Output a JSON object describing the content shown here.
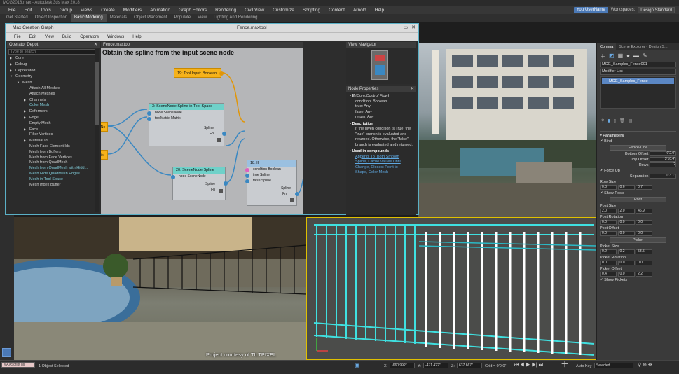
{
  "window": {
    "title": "MCG2018.max - Autodesk 3ds Max 2018"
  },
  "menubar": {
    "items": [
      "File",
      "Edit",
      "Tools",
      "Group",
      "Views",
      "Create",
      "Modifiers",
      "Animation",
      "Graph Editors",
      "Rendering",
      "Civil View",
      "Customize",
      "Scripting",
      "Content",
      "Arnold",
      "Help"
    ]
  },
  "user": {
    "name": "YourUserName",
    "workspaces_label": "Workspaces:",
    "workspace": "Design Standard"
  },
  "ribbon": {
    "tabs": [
      "Get Started",
      "Object Inspection",
      "Basic Modeling",
      "Materials",
      "Object Placement",
      "Populate",
      "View",
      "Lighting And Rendering"
    ],
    "active": 2
  },
  "mcg": {
    "title": "Max Creation Graph",
    "path": "Fence.maxtool",
    "menu": [
      "File",
      "Edit",
      "View",
      "Build",
      "Operators",
      "Windows",
      "Help"
    ],
    "operator_depot": {
      "title": "Operator Depot",
      "search_placeholder": "Type to search",
      "items": [
        {
          "label": "Core",
          "indent": 0,
          "arrow": "▶"
        },
        {
          "label": "Debug",
          "indent": 0,
          "arrow": "▶"
        },
        {
          "label": "Deprecated",
          "indent": 0,
          "arrow": "▶"
        },
        {
          "label": "Geometry",
          "indent": 0,
          "arrow": "▼"
        },
        {
          "label": "Mesh",
          "indent": 1,
          "arrow": "▼"
        },
        {
          "label": "Attach All Meshes",
          "indent": 2,
          "arrow": ""
        },
        {
          "label": "Attach Meshes",
          "indent": 2,
          "arrow": ""
        },
        {
          "label": "Channels",
          "indent": 2,
          "arrow": "▶"
        },
        {
          "label": "Color Mesh",
          "indent": 2,
          "arrow": "",
          "hl": true
        },
        {
          "label": "Deformers",
          "indent": 2,
          "arrow": "▶"
        },
        {
          "label": "Edge",
          "indent": 2,
          "arrow": "▶"
        },
        {
          "label": "Empty Mesh",
          "indent": 2,
          "arrow": ""
        },
        {
          "label": "Face",
          "indent": 2,
          "arrow": "▶"
        },
        {
          "label": "Filter Vertices",
          "indent": 2,
          "arrow": ""
        },
        {
          "label": "Material Id",
          "indent": 2,
          "arrow": "▶"
        },
        {
          "label": "Mesh Face Element Ids",
          "indent": 2,
          "arrow": ""
        },
        {
          "label": "Mesh from Buffers",
          "indent": 2,
          "arrow": ""
        },
        {
          "label": "Mesh from Face Vertices",
          "indent": 2,
          "arrow": ""
        },
        {
          "label": "Mesh from QuadMesh",
          "indent": 2,
          "arrow": ""
        },
        {
          "label": "Mesh from QuadMesh with Hidd...",
          "indent": 2,
          "arrow": "",
          "hl": true
        },
        {
          "label": "Mesh Hide QuadMesh Edges",
          "indent": 2,
          "arrow": "",
          "hl": true
        },
        {
          "label": "Mesh in Tool Space",
          "indent": 2,
          "arrow": "",
          "hl": true
        },
        {
          "label": "Mesh Index Buffer",
          "indent": 2,
          "arrow": ""
        }
      ]
    },
    "graph": {
      "tab": "Fence.maxtool",
      "title": "Obtain the spline from the input scene node",
      "nodes": {
        "n1": {
          "title": "19: Tool Input: Boolean"
        },
        "n2": {
          "title": "3: SceneNode Spline in Tool Space",
          "rows": [
            "node SceneNode",
            "toolMatrix Matrix"
          ],
          "outs": [
            "Spline",
            "Fn"
          ]
        },
        "n3": {
          "title": "20: SceneNode Spline",
          "rows": [
            "node SceneNode"
          ],
          "outs": [
            "Spline",
            "Fn"
          ]
        },
        "n4": {
          "title": "18: If",
          "rows": [
            "condition Boolean",
            "true Spline",
            "false Spline"
          ],
          "outs": [
            "Spline",
            "Fn"
          ]
        },
        "stub1": "eNo",
        "stub2": "trix"
      }
    },
    "navigator": {
      "title": "View Navigator"
    },
    "node_properties": {
      "title": "Node Properties",
      "heading": "If",
      "heading_type": "(Core.Control Flow)",
      "params": [
        "condition: Boolean",
        "true: Any",
        "false: Any",
        "return: Any"
      ],
      "desc_title": "Description",
      "description": "If the given condition is True, the \"true\" branch is evaluated and returned. Otherwise, the \"false\" branch is evaluated and returned.",
      "used_title": "Used in compounds",
      "links": [
        "Append_To_Both Smooth",
        "Spline, Cache Values Until",
        "Change, Closest Point to",
        "Shape, Color Mesh"
      ]
    }
  },
  "viewport_br": {
    "credit": "Project courtesy of TILTPIXEL"
  },
  "right_panel": {
    "tabs": [
      "Comma",
      "Scene Explorer - Design S..."
    ],
    "object_name": "MCG_Samples_Fence001",
    "modifier_list": "Modifier List",
    "stack_item": "MCG_Samples_Fence",
    "params_title": "Parameters",
    "bind": "Bind",
    "fence_line_btn": "Fence-Line",
    "bottom_offset_label": "Bottom Offset",
    "bottom_offset": "0'2.0\"",
    "top_offset_label": "Top Offset",
    "top_offset": "3'10.4\"",
    "rows_label": "Rows",
    "rows": "2",
    "force_up": "Force Up",
    "separation_label": "Separation",
    "separation": "0'3.1\"",
    "row_size": "Row Size",
    "row_size_vals": [
      "0.3",
      "0.6",
      "0.7"
    ],
    "show_posts": "Show Posts",
    "post_btn": "Post",
    "post_size": "Post Size",
    "post_size_vals": [
      "2.0",
      "2.0",
      "46.9"
    ],
    "post_rotation": "Post Rotation",
    "post_rotation_vals": [
      "0.0",
      "0.0",
      "0.0"
    ],
    "post_offset": "Post Offset",
    "post_offset_vals": [
      "0.0",
      "0.0",
      "0.0"
    ],
    "picket_btn": "Picket",
    "picket_size": "Picket Size",
    "picket_size_vals": [
      "0.2",
      "0.2",
      "53.5"
    ],
    "picket_rotation": "Picket Rotation",
    "picket_rotation_vals": [
      "0.0",
      "0.0",
      "0.0"
    ],
    "picket_offset": "Picket Offset",
    "picket_offset_vals": [
      "0.4",
      "0.0",
      "2.2"
    ],
    "show_pickets": "Show Pickets"
  },
  "status": {
    "script_label": "MAXScript Mi",
    "selected": "1 Object Selected",
    "x_label": "X:",
    "x": "-660.992\"",
    "y_label": "Y:",
    "y": "-471.422\"",
    "z_label": "Z:",
    "z": "637.667\"",
    "grid": "Grid = 0'0.0\"",
    "autokey": "Auto Key",
    "selected_dd": "Selected"
  }
}
